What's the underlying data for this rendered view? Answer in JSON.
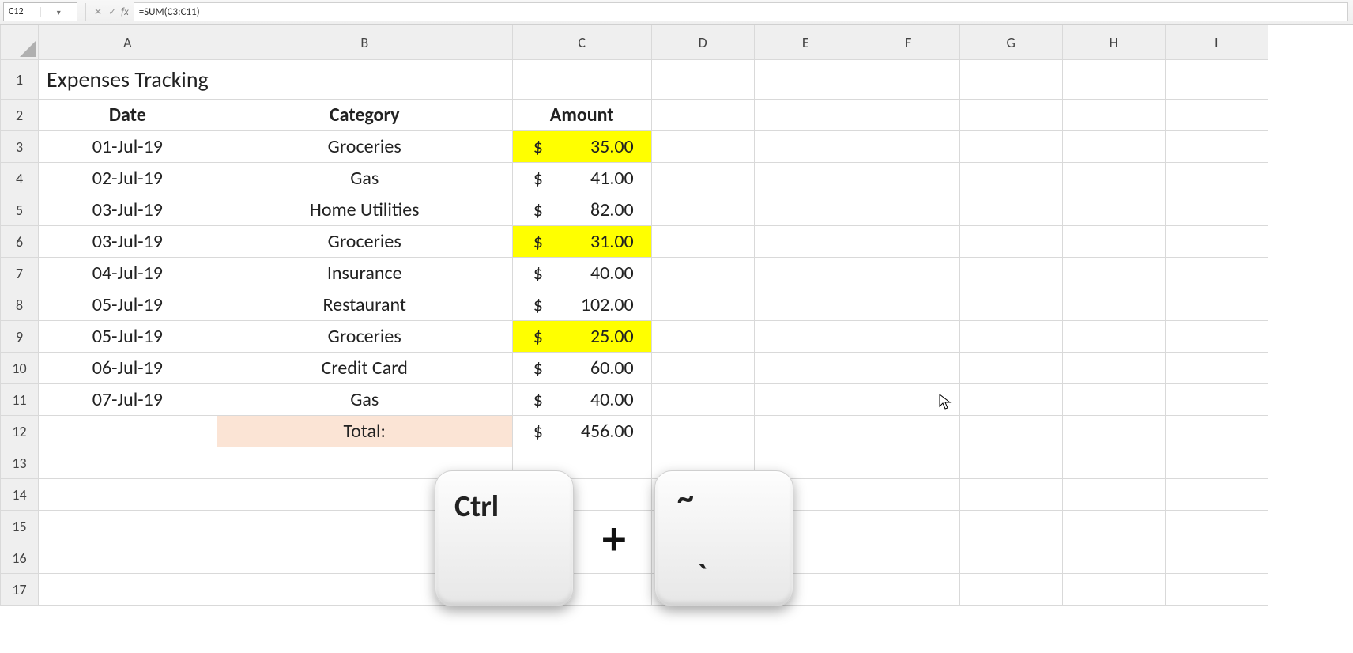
{
  "formula_bar": {
    "name_box": "C12",
    "formula": "=SUM(C3:C11)"
  },
  "columns": [
    "A",
    "B",
    "C",
    "D",
    "E",
    "F",
    "G",
    "H",
    "I"
  ],
  "rows": [
    "1",
    "2",
    "3",
    "4",
    "5",
    "6",
    "7",
    "8",
    "9",
    "10",
    "11",
    "12",
    "13",
    "14",
    "15",
    "16",
    "17"
  ],
  "sheet": {
    "title": "Expenses Tracking",
    "headers": {
      "a": "Date",
      "b": "Category",
      "c": "Amount"
    },
    "data": [
      {
        "date": "01-Jul-19",
        "cat": "Groceries",
        "amt": "35.00",
        "hl": true
      },
      {
        "date": "02-Jul-19",
        "cat": "Gas",
        "amt": "41.00",
        "hl": false
      },
      {
        "date": "03-Jul-19",
        "cat": "Home Utilities",
        "amt": "82.00",
        "hl": false
      },
      {
        "date": "03-Jul-19",
        "cat": "Groceries",
        "amt": "31.00",
        "hl": true
      },
      {
        "date": "04-Jul-19",
        "cat": "Insurance",
        "amt": "40.00",
        "hl": false
      },
      {
        "date": "05-Jul-19",
        "cat": "Restaurant",
        "amt": "102.00",
        "hl": false
      },
      {
        "date": "05-Jul-19",
        "cat": "Groceries",
        "amt": "25.00",
        "hl": true
      },
      {
        "date": "06-Jul-19",
        "cat": "Credit Card",
        "amt": "60.00",
        "hl": false
      },
      {
        "date": "07-Jul-19",
        "cat": "Gas",
        "amt": "40.00",
        "hl": false
      }
    ],
    "total_label": "Total:",
    "total_amt": "456.00",
    "currency": "$"
  },
  "keys": {
    "left": "Ctrl",
    "plus": "+",
    "right_top": "~",
    "right_bot": "`"
  }
}
